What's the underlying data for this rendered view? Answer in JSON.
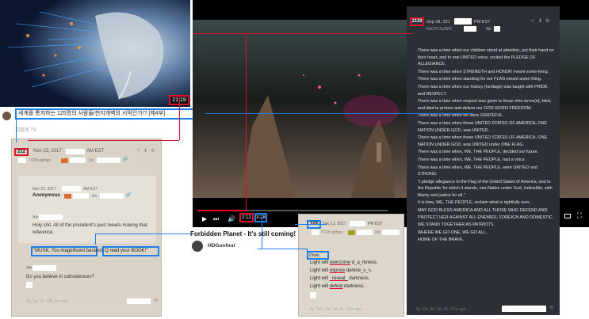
{
  "thumbnail": {
    "duration": "21:19"
  },
  "video_meta": {
    "title": "세계를 통치하는 125명의 사람들/천지개벽의 서막인가!? [제4부]",
    "channel": "김필제 TV"
  },
  "player": {
    "current_time": "2:12",
    "remaining": "3:28",
    "movie_label": "Forbidden Planet - It's still coming!",
    "uploader": "HDGoofnut"
  },
  "post1": {
    "number": "212",
    "date": "Nov 23, 2017",
    "tz": "AM EST",
    "trip": "!ITPb.qbhqo",
    "tag": "No",
    "quote_date": "Nov 23, 2017",
    "quote_tz": "AM EST",
    "quote_author": "Anonymous",
    "quote_tag": "No",
    "line1": ">>",
    "line2": "Holy shit. All of the president's past tweets making that reference.",
    "line3a": "\"MUSK. You magnificent bastard.",
    "line3b": "Q read your BOOK!\"",
    "line4": ">>",
    "line5": "Do you believe in coincidences?",
    "footer": "7y, 1w, 2d, 14h, 5m ago"
  },
  "post2": {
    "number": "328",
    "date": "Dec 11, 2017",
    "tz": "PM EST",
    "trip": "!ITPb.qbhqo",
    "tag": "No",
    "line1": "/Owls.",
    "light1_pre": "Light will ",
    "light1_word": "overcome",
    "light1_post": " d_a_rkness.",
    "light2_pre": "Light will ",
    "light2_word": "expose",
    "light2_post": " darkne_s_s.",
    "light3_pre": "Light will ",
    "light3_word": "_reveal_",
    "light3_post": " darkness.",
    "light4_pre": "Light will ",
    "light4_word": "defeat",
    "light4_post": " darkness.",
    "footer": "6y, 11m, 3w, 1d, 0h, 13m ago"
  },
  "post3": {
    "number": "2119",
    "date": "Sep 08, 201",
    "tz": "PM EST",
    "trip": "!!mG7VJxZNCI",
    "tag": "No",
    "lines": [
      "There was a time when our children stood at attention, put their hand on their heart, and in one UNITED voice, recited the PLEDGE OF ALLEGIANCE.",
      "There was a time when STRENGTH and HONOR meant some-thing.",
      "There was a time when standing for our FLAG meant some-thing.",
      "There was a time when our history (heritage) was taught with PRIDE and RESPECT.",
      "There was a time when respect was given to those who serve(d), bled, and died to protect and deliver our GOD GIVEN FREEDOM.",
      "There was a time when we were GRATEFUL.",
      "There was a time when these UNITED STATES OF AMERICA, ONE NATION UNDER GOD, was UNITED.",
      "There was a time when these UNITED STATES OF AMERICA, ONE NATION UNDER GOD, was UNITED under ONE FLAG.",
      "There was a time when, WE, THE PEOPLE, decided our future.",
      "There was a time when, WE, THE PEOPLE, had a voice.",
      "There was a time when, WE, THE PEOPLE, were UNITED and STRONG.",
      "\"I pledge allegiance to the Flag of the United States of America, and to the Republic for which it stands, one Nation under God, indivisible, with liberty and justice for all.\"",
      "It is time, WE, THE PEOPLE, reclaim what is rightfully ours.",
      "MAY GOD BLESS AMERICA AND ALL THOSE WHO DEFEND AND PROTECT HER AGAINST ALL ENEMIES, FOREIGN AND DOMESTIC.",
      "WE STAND TOGETHER AS PATRIOTS.",
      "WHERE WE GO ONE, WE GO ALL.",
      "HOME OF THE BRAVE."
    ],
    "footer": "6y, 2m, 3w, 5d, 1h, 17m ago"
  },
  "colors": {
    "highlight_red": "#e0102a",
    "highlight_blue": "#1a80e8",
    "post_bg": "#d9d3c8",
    "dark_post_bg": "#2c2f35"
  }
}
